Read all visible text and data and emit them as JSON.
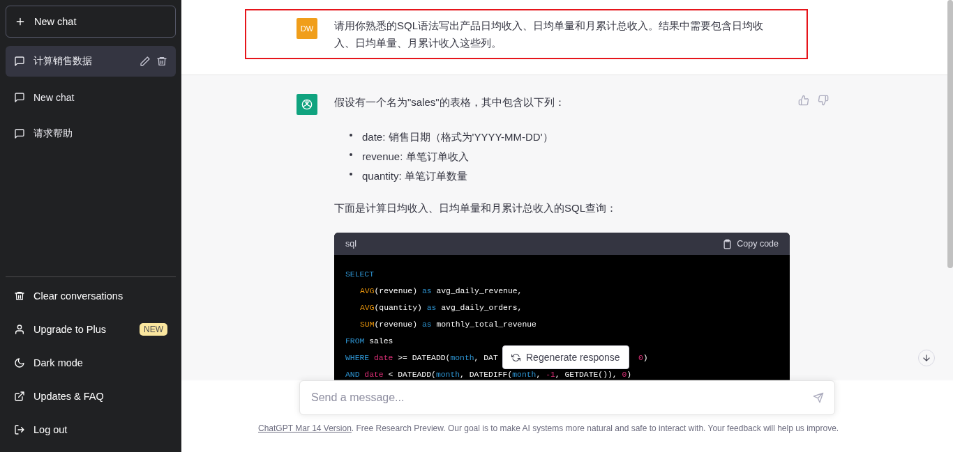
{
  "sidebar": {
    "new_chat": "New chat",
    "conversations": [
      {
        "title": "计算销售数据",
        "selected": true
      },
      {
        "title": "New chat",
        "selected": false
      },
      {
        "title": "请求帮助",
        "selected": false
      }
    ],
    "menu": [
      {
        "kind": "trash",
        "label": "Clear conversations"
      },
      {
        "kind": "user",
        "label": "Upgrade to Plus",
        "badge": "NEW"
      },
      {
        "kind": "moon",
        "label": "Dark mode"
      },
      {
        "kind": "external",
        "label": "Updates & FAQ"
      },
      {
        "kind": "logout",
        "label": "Log out"
      }
    ]
  },
  "user_message": {
    "avatar": "DW",
    "text": "请用你熟悉的SQL语法写出产品日均收入、日均单量和月累计总收入。结果中需要包含日均收入、日均单量、月累计收入这些列。"
  },
  "assistant_message": {
    "intro": "假设有一个名为\"sales\"的表格，其中包含以下列：",
    "bullets": [
      "date: 销售日期（格式为'YYYY-MM-DD'）",
      "revenue: 单笔订单收入",
      "quantity: 单笔订单数量"
    ],
    "lead": "下面是计算日均收入、日均单量和月累计总收入的SQL查询：",
    "code": {
      "language": "sql",
      "copy_label": "Copy code",
      "lines": [
        {
          "tokens": [
            {
              "keyword": "SELECT"
            }
          ]
        },
        {
          "indent": true,
          "tokens": [
            {
              "function": "AVG"
            },
            {
              "plain": "(revenue) "
            },
            {
              "keyword": "as"
            },
            {
              "plain": " avg_daily_revenue,"
            }
          ]
        },
        {
          "indent": true,
          "tokens": [
            {
              "function": "AVG"
            },
            {
              "plain": "(quantity) "
            },
            {
              "keyword": "as"
            },
            {
              "plain": " avg_daily_orders,"
            }
          ]
        },
        {
          "indent": true,
          "tokens": [
            {
              "function": "SUM"
            },
            {
              "plain": "(revenue) "
            },
            {
              "keyword": "as"
            },
            {
              "plain": " monthly_total_revenue"
            }
          ]
        },
        {
          "tokens": [
            {
              "keyword": "FROM"
            },
            {
              "plain": " sales"
            }
          ]
        },
        {
          "tokens": [
            {
              "keyword": "WHERE "
            },
            {
              "variable": "date"
            },
            {
              "plain": " >= DATEADD("
            },
            {
              "keyword": "month"
            },
            {
              "plain": ", DAT"
            }
          ],
          "tail": [
            {
              "number": "0"
            },
            {
              "plain": ")"
            }
          ]
        },
        {
          "tokens": [
            {
              "keyword": "AND "
            },
            {
              "variable": "date"
            },
            {
              "plain": " < DATEADD("
            },
            {
              "keyword": "month"
            },
            {
              "plain": ", DATEDIFF("
            },
            {
              "keyword": "month"
            },
            {
              "plain": ", "
            },
            {
              "number": "-1"
            },
            {
              "plain": ", GETDATE()), "
            },
            {
              "number": "0"
            },
            {
              "plain": ")"
            }
          ]
        }
      ]
    }
  },
  "regenerate": "Regenerate response",
  "composer": {
    "placeholder": "Send a message..."
  },
  "footer": {
    "link": "ChatGPT Mar 14 Version",
    "text": ". Free Research Preview. Our goal is to make AI systems more natural and safe to interact with. Your feedback will help us improve."
  }
}
